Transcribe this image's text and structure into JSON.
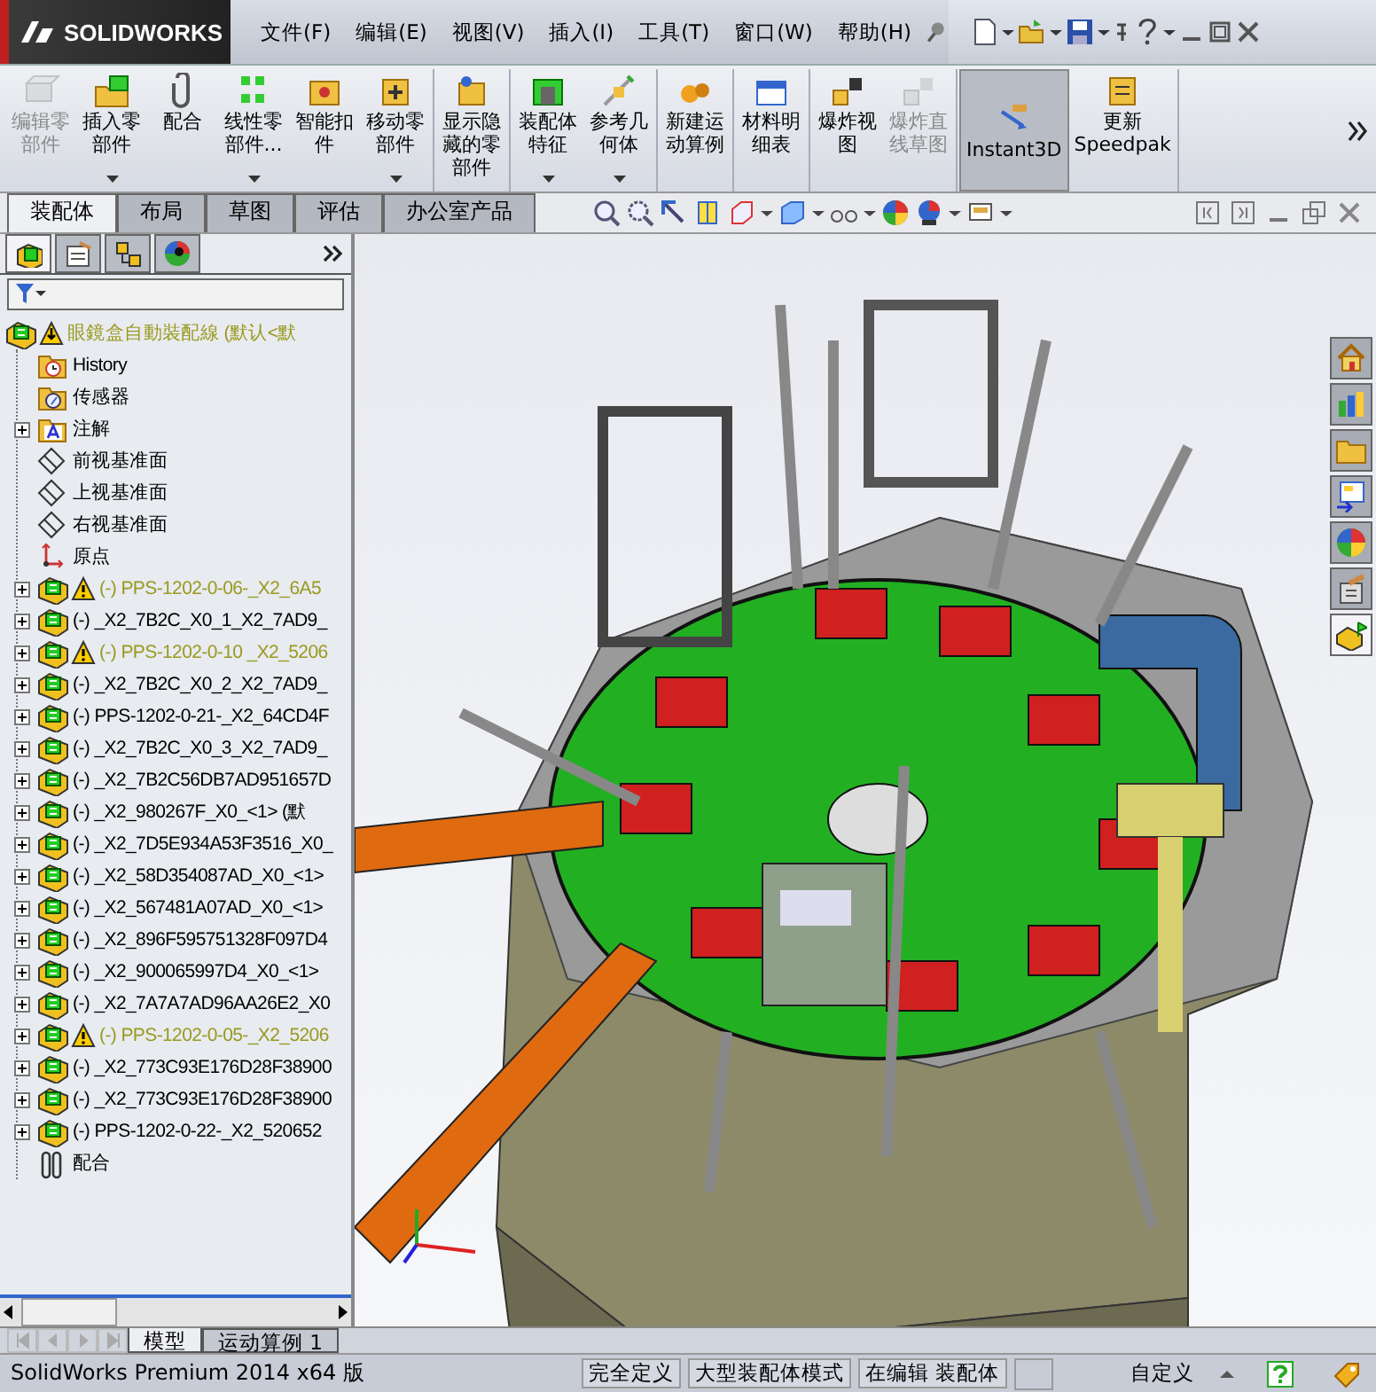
{
  "app": {
    "logo": "SOLIDWORKS"
  },
  "menu": [
    "文件(F)",
    "编辑(E)",
    "视图(V)",
    "插入(I)",
    "工具(T)",
    "窗口(W)",
    "帮助(H)"
  ],
  "ribbon": [
    [
      {
        "label": "编辑零部件",
        "disabled": true,
        "dropdown": false
      },
      {
        "label": "插入零部件",
        "disabled": false,
        "dropdown": true
      },
      {
        "label": "配合",
        "disabled": false,
        "dropdown": false
      },
      {
        "label": "线性零部件...",
        "disabled": false,
        "dropdown": true
      },
      {
        "label": "智能扣件",
        "disabled": false,
        "dropdown": false
      },
      {
        "label": "移动零部件",
        "disabled": false,
        "dropdown": true
      }
    ],
    [
      {
        "label": "显示隐藏的零部件",
        "disabled": false,
        "dropdown": false
      }
    ],
    [
      {
        "label": "装配体特征",
        "disabled": false,
        "dropdown": true
      },
      {
        "label": "参考几何体",
        "disabled": false,
        "dropdown": true
      }
    ],
    [
      {
        "label": "新建运动算例",
        "disabled": false,
        "dropdown": false
      }
    ],
    [
      {
        "label": "材料明细表",
        "disabled": false,
        "dropdown": false
      }
    ],
    [
      {
        "label": "爆炸视图",
        "disabled": false,
        "dropdown": false
      },
      {
        "label": "爆炸直线草图",
        "disabled": true,
        "dropdown": false
      }
    ],
    [
      {
        "label": "Instant3D",
        "disabled": false,
        "dropdown": false,
        "selected": true
      },
      {
        "label": "更新Speedpak",
        "disabled": false,
        "dropdown": false,
        "selected": false
      }
    ]
  ],
  "command_tabs": [
    {
      "label": "装配体",
      "selected": true
    },
    {
      "label": "布局",
      "selected": false
    },
    {
      "label": "草图",
      "selected": false
    },
    {
      "label": "评估",
      "selected": false
    },
    {
      "label": "办公室产品",
      "selected": false
    }
  ],
  "panel_tabs": [
    {
      "selected": true
    },
    {
      "selected": false
    },
    {
      "selected": false
    },
    {
      "selected": false
    }
  ],
  "tree": {
    "label": "眼鏡盒自動裝配線 (默认<默",
    "warning": true,
    "children": [
      {
        "label": "History",
        "kind": "history",
        "expandable": false,
        "warning": false
      },
      {
        "label": "传感器",
        "kind": "sensor",
        "expandable": false,
        "warning": false
      },
      {
        "label": "注解",
        "kind": "annotation",
        "expandable": true,
        "warning": false
      },
      {
        "label": "前视基准面",
        "kind": "plane",
        "expandable": false,
        "warning": false
      },
      {
        "label": "上视基准面",
        "kind": "plane",
        "expandable": false,
        "warning": false
      },
      {
        "label": "右视基准面",
        "kind": "plane",
        "expandable": false,
        "warning": false
      },
      {
        "label": "原点",
        "kind": "origin",
        "expandable": false,
        "warning": false
      },
      {
        "label": "(-) PPS-1202-0-06-_X2_6A5",
        "kind": "part",
        "expandable": true,
        "warning": true
      },
      {
        "label": "(-) _X2_7B2C_X0_1_X2_7AD9_",
        "kind": "part",
        "expandable": true,
        "warning": false
      },
      {
        "label": "(-) PPS-1202-0-10 _X2_5206",
        "kind": "part",
        "expandable": true,
        "warning": true
      },
      {
        "label": "(-) _X2_7B2C_X0_2_X2_7AD9_",
        "kind": "part",
        "expandable": true,
        "warning": false
      },
      {
        "label": "(-) PPS-1202-0-21-_X2_64CD4F",
        "kind": "part",
        "expandable": true,
        "warning": false
      },
      {
        "label": "(-) _X2_7B2C_X0_3_X2_7AD9_",
        "kind": "part",
        "expandable": true,
        "warning": false
      },
      {
        "label": "(-) _X2_7B2C56DB7AD951657D",
        "kind": "part",
        "expandable": true,
        "warning": false
      },
      {
        "label": "(-) _X2_980267F_X0_<1> (默",
        "kind": "part",
        "expandable": true,
        "warning": false
      },
      {
        "label": "(-) _X2_7D5E934A53F3516_X0_",
        "kind": "part",
        "expandable": true,
        "warning": false
      },
      {
        "label": "(-) _X2_58D354087AD_X0_<1>",
        "kind": "part",
        "expandable": true,
        "warning": false
      },
      {
        "label": "(-) _X2_567481A07AD_X0_<1>",
        "kind": "part",
        "expandable": true,
        "warning": false
      },
      {
        "label": "(-) _X2_896F595751328F097D4",
        "kind": "part",
        "expandable": true,
        "warning": false
      },
      {
        "label": "(-) _X2_900065997D4_X0_<1>",
        "kind": "part",
        "expandable": true,
        "warning": false
      },
      {
        "label": "(-) _X2_7A7A7AD96AA26E2_X0",
        "kind": "part",
        "expandable": true,
        "warning": false
      },
      {
        "label": "(-) PPS-1202-0-05-_X2_5206",
        "kind": "part",
        "expandable": true,
        "warning": true
      },
      {
        "label": "(-) _X2_773C93E176D28F38900",
        "kind": "part",
        "expandable": true,
        "warning": false
      },
      {
        "label": "(-) _X2_773C93E176D28F38900",
        "kind": "part",
        "expandable": true,
        "warning": false
      },
      {
        "label": "(-) PPS-1202-0-22-_X2_520652",
        "kind": "part",
        "expandable": true,
        "warning": false
      },
      {
        "label": "配合",
        "kind": "mates",
        "expandable": false,
        "warning": false
      }
    ]
  },
  "task_pane": [
    {
      "selected": false
    },
    {
      "selected": false
    },
    {
      "selected": false
    },
    {
      "selected": false
    },
    {
      "selected": false
    },
    {
      "selected": false
    },
    {
      "selected": true
    }
  ],
  "bottom_tabs": [
    {
      "label": "模型",
      "selected": true
    },
    {
      "label": "运动算例 1",
      "selected": false
    }
  ],
  "status_bar": {
    "product": "SolidWorks Premium 2014 x64 版",
    "fields": [
      "完全定义",
      "大型装配体模式",
      "在编辑 装配体"
    ],
    "units": "自定义"
  }
}
